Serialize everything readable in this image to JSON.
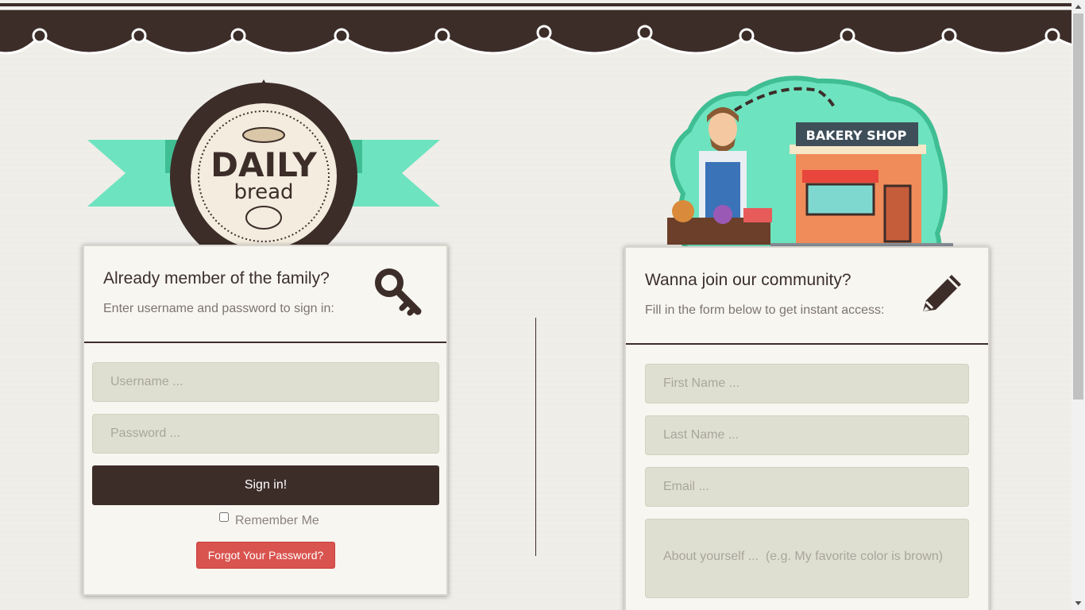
{
  "login": {
    "title": "Already member of the family?",
    "subtitle": "Enter username and password to sign in:",
    "username_placeholder": "Username ...",
    "password_placeholder": "Password ...",
    "signin_label": "Sign in!",
    "remember_label": "Remember Me",
    "forgot_label": "Forgot Your Password?"
  },
  "signup": {
    "title": "Wanna join our community?",
    "subtitle": "Fill in the form below to get instant access:",
    "firstname_placeholder": "First Name ...",
    "lastname_placeholder": "Last Name ...",
    "email_placeholder": "Email ...",
    "about_placeholder": "About yourself ...  (e.g. My favorite color is brown)"
  },
  "logo": {
    "word1": "DAILY",
    "word2": "bread"
  },
  "shop": {
    "sign": "BAKERY SHOP"
  },
  "colors": {
    "brown": "#3d2d29",
    "mint": "#6ee3bf",
    "danger": "#d9534f",
    "field": "#dfdfd1"
  },
  "icons": {
    "login": "key-icon",
    "signup": "pencil-icon"
  }
}
